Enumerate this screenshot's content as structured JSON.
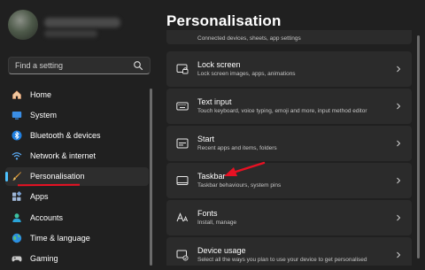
{
  "search": {
    "placeholder": "Find a setting"
  },
  "nav": {
    "items": [
      {
        "label": "Home",
        "icon": "home-icon"
      },
      {
        "label": "System",
        "icon": "display-icon"
      },
      {
        "label": "Bluetooth & devices",
        "icon": "bluetooth-icon"
      },
      {
        "label": "Network & internet",
        "icon": "wifi-icon"
      },
      {
        "label": "Personalisation",
        "icon": "paintbrush-icon",
        "active": true
      },
      {
        "label": "Apps",
        "icon": "apps-icon"
      },
      {
        "label": "Accounts",
        "icon": "account-icon"
      },
      {
        "label": "Time & language",
        "icon": "globe-icon"
      },
      {
        "label": "Gaming",
        "icon": "gamepad-icon"
      }
    ]
  },
  "main": {
    "title": "Personalisation",
    "partial_subtitle": "Connected devices, sheets, app settings",
    "cards": [
      {
        "title": "Lock screen",
        "subtitle": "Lock screen images, apps, animations",
        "icon": "lock-screen-icon"
      },
      {
        "title": "Text input",
        "subtitle": "Touch keyboard, voice typing, emoji and more, input method editor",
        "icon": "keyboard-icon"
      },
      {
        "title": "Start",
        "subtitle": "Recent apps and items, folders",
        "icon": "start-icon"
      },
      {
        "title": "Taskbar",
        "subtitle": "Taskbar behaviours, system pins",
        "icon": "taskbar-icon"
      },
      {
        "title": "Fonts",
        "subtitle": "Install, manage",
        "icon": "fonts-icon"
      },
      {
        "title": "Device usage",
        "subtitle": "Select all the ways you plan to use your device to get personalised",
        "icon": "device-usage-icon"
      }
    ]
  },
  "colors": {
    "accent": "#4cc2ff",
    "annotation": "#e81123",
    "background": "#202020",
    "card": "#2b2b2b"
  }
}
